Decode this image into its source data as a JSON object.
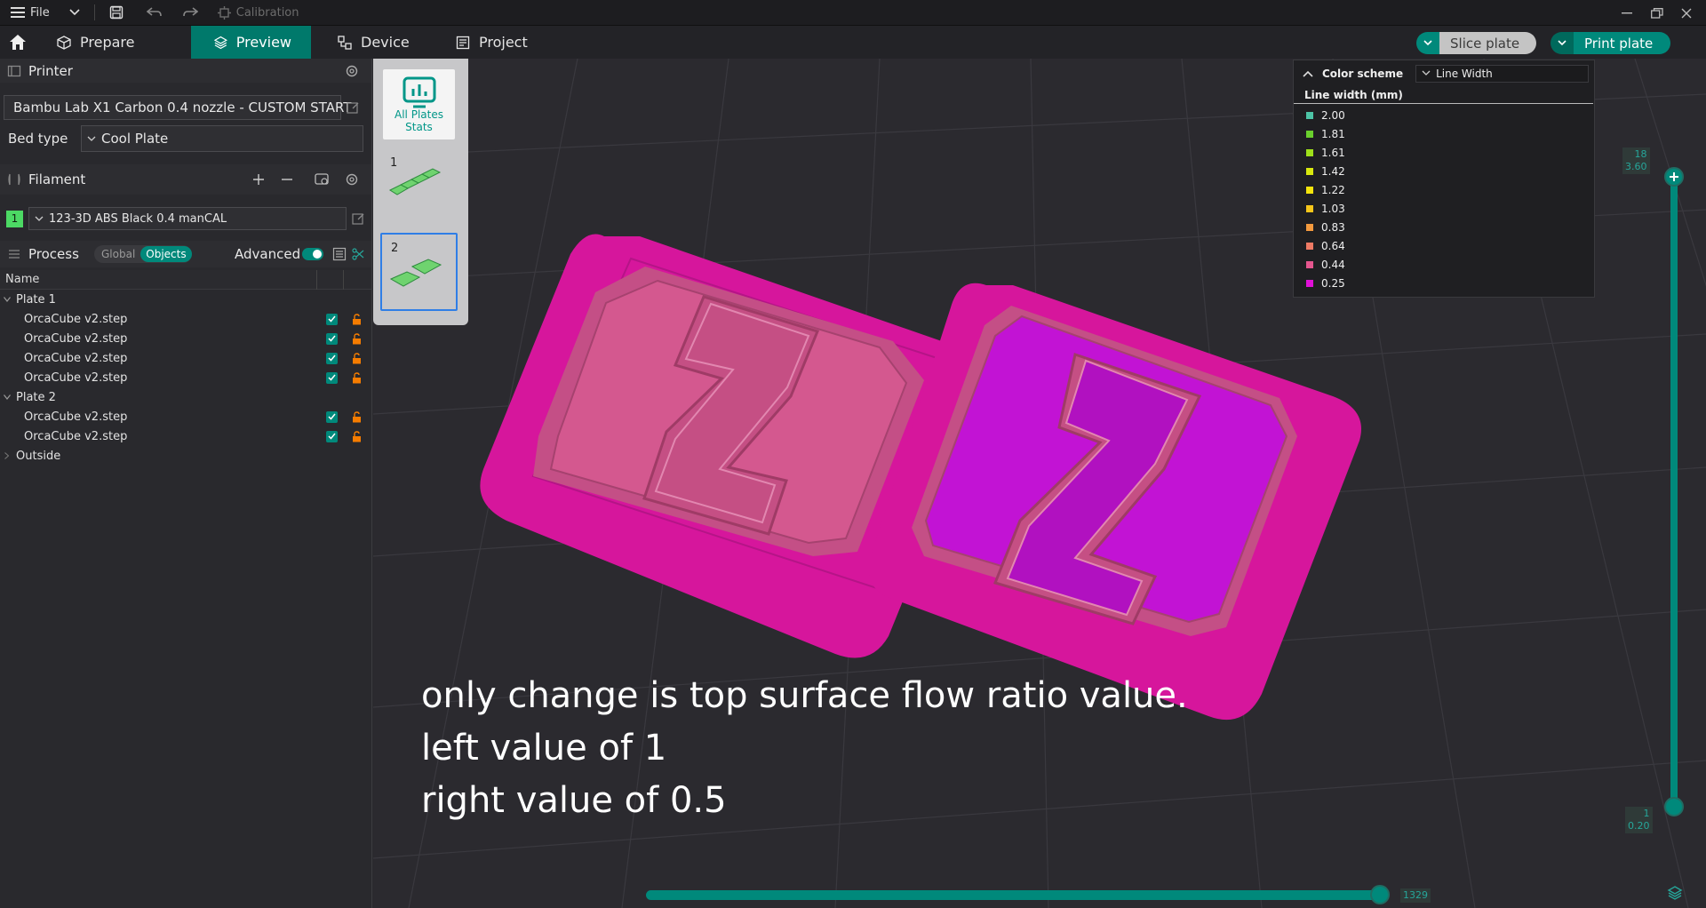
{
  "titlebar": {
    "file_label": "File",
    "calibration_label": "Calibration"
  },
  "tabs": [
    {
      "label": "Prepare"
    },
    {
      "label": "Preview"
    },
    {
      "label": "Device"
    },
    {
      "label": "Project"
    }
  ],
  "actions": {
    "slice_label": "Slice plate",
    "print_label": "Print plate"
  },
  "printer": {
    "section_label": "Printer",
    "preset": "Bambu Lab X1 Carbon 0.4 nozzle - CUSTOM START",
    "bed_type_label": "Bed type",
    "bed_type_value": "Cool Plate"
  },
  "filament": {
    "section_label": "Filament",
    "index": "1",
    "preset": "123-3D ABS Black 0.4 manCAL",
    "color": "#4cd964"
  },
  "process": {
    "section_label": "Process",
    "global_label": "Global",
    "objects_label": "Objects",
    "advanced_label": "Advanced"
  },
  "tree": {
    "name_header": "Name",
    "plate1": {
      "label": "Plate 1",
      "items": [
        "OrcaCube v2.step",
        "OrcaCube v2.step",
        "OrcaCube v2.step",
        "OrcaCube v2.step"
      ]
    },
    "plate2": {
      "label": "Plate 2",
      "items": [
        "OrcaCube v2.step",
        "OrcaCube v2.step"
      ]
    },
    "outside_label": "Outside"
  },
  "plates_panel": {
    "stats_label_1": "All Plates",
    "stats_label_2": "Stats",
    "plate1_num": "1",
    "plate2_num": "2"
  },
  "legend": {
    "header_label": "Color scheme",
    "scheme_value": "Line Width",
    "title": "Line width (mm)",
    "items": [
      {
        "value": "2.00",
        "color": "#4dc4a6"
      },
      {
        "value": "1.81",
        "color": "#6ad02d"
      },
      {
        "value": "1.61",
        "color": "#9fe01a"
      },
      {
        "value": "1.42",
        "color": "#d8e80e"
      },
      {
        "value": "1.22",
        "color": "#f4e40c"
      },
      {
        "value": "1.03",
        "color": "#f6c61a"
      },
      {
        "value": "0.83",
        "color": "#f49a3e"
      },
      {
        "value": "0.64",
        "color": "#ee7a64"
      },
      {
        "value": "0.44",
        "color": "#e5568e"
      },
      {
        "value": "0.25",
        "color": "#e010d8"
      }
    ]
  },
  "layer_slider": {
    "top_layer": "18",
    "top_height": "3.60",
    "bottom_layer": "1",
    "bottom_height": "0.20",
    "move_value": "1329"
  },
  "annotation": {
    "line1": "only change is top surface flow ratio value.",
    "line2": "left value of 1",
    "line3": "right value of 0.5"
  }
}
